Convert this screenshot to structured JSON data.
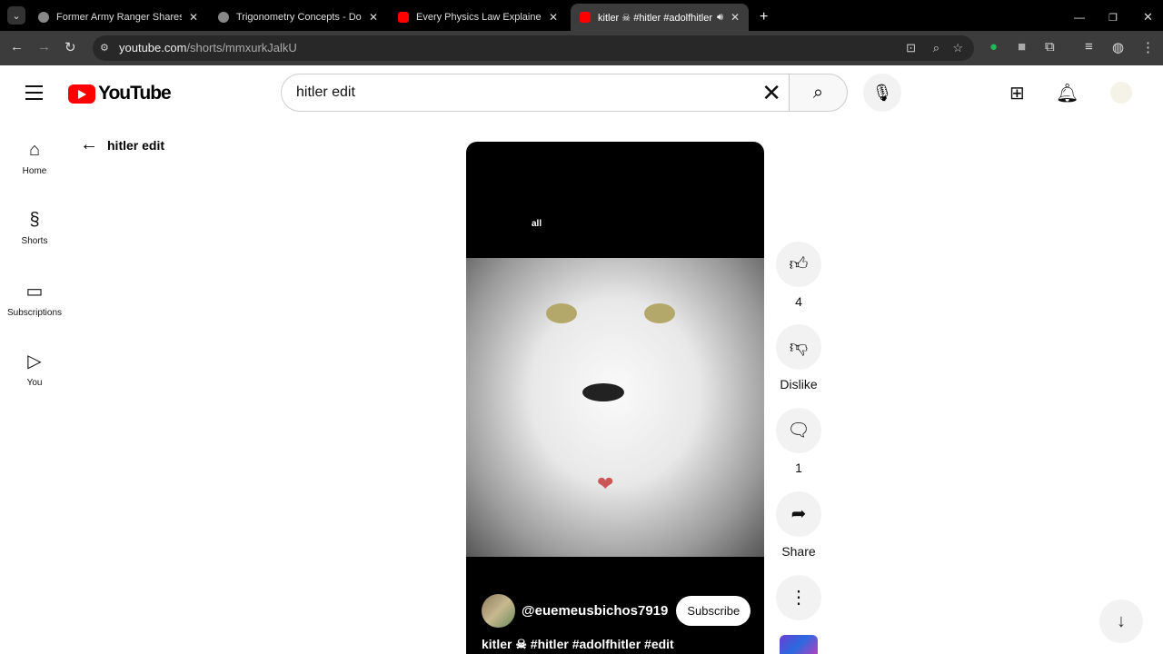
{
  "browser": {
    "tabs": [
      {
        "title": "Former Army Ranger Shares His",
        "icon": "globe-icon"
      },
      {
        "title": "Trigonometry Concepts - Don't",
        "icon": "globe-icon"
      },
      {
        "title": "Every Physics Law Explained in",
        "icon": "youtube-icon"
      },
      {
        "title": "kitler ☠ #hitler #adolfhitler",
        "icon": "youtube-icon",
        "active": true
      }
    ],
    "url_host": "youtube.com",
    "url_path": "/shorts/mmxurkJalkU"
  },
  "header": {
    "logo": "YouTube",
    "search_value": "hitler edit"
  },
  "sidebar": {
    "items": [
      {
        "label": "Home"
      },
      {
        "label": "Shorts"
      },
      {
        "label": "Subscriptions"
      },
      {
        "label": "You"
      }
    ]
  },
  "back_label": "hitler edit",
  "short": {
    "overlay_text": "all",
    "channel": "@euemeusbichos7919",
    "subscribe": "Subscribe",
    "title": "kitler ☠ #hitler #adolfhitler #edit"
  },
  "actions": {
    "likes": "4",
    "dislike": "Dislike",
    "comments": "1",
    "share": "Share"
  }
}
